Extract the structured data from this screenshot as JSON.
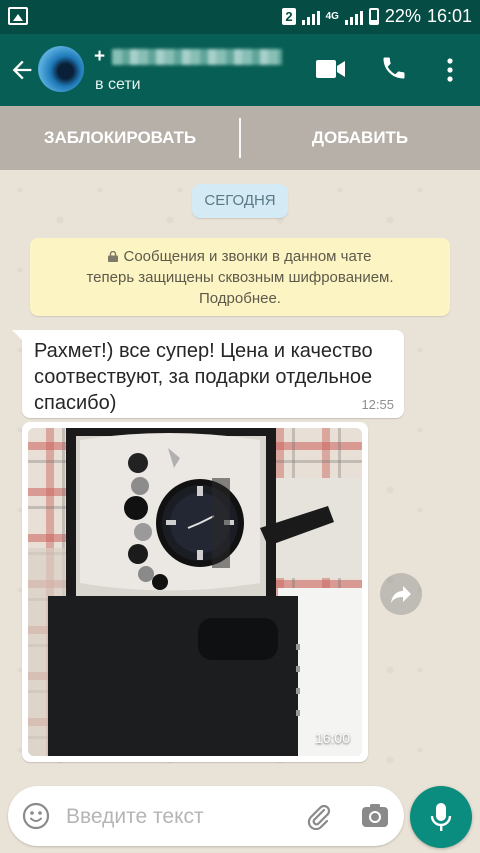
{
  "statusbar": {
    "sim": "2",
    "network": "4G",
    "battery": "22%",
    "time": "16:01"
  },
  "header": {
    "name_prefix": "+",
    "status": "в сети"
  },
  "actions": {
    "block_label": "ЗАБЛОКИРОВАТЬ",
    "add_label": "ДОБАВИТЬ"
  },
  "chat": {
    "date_chip": "СЕГОДНЯ",
    "encryption_notice": {
      "line1": "Сообщения и звонки в данном чате",
      "line2": "теперь защищены сквозным шифрованием.",
      "line3": "Подробнее."
    },
    "messages": [
      {
        "text": "Рахмет!) все супер! Цена и качество соотвествуют, за подарки отдельное спасибо)",
        "time": "12:55"
      },
      {
        "type": "image",
        "time": "16:00"
      }
    ]
  },
  "composer": {
    "placeholder": "Введите текст"
  },
  "colors": {
    "statusbar": "#054d44",
    "header": "#075e54",
    "accent": "#0a8d7e",
    "notice_bg": "#fdf4c4",
    "date_chip_bg": "#d4eaf4"
  }
}
